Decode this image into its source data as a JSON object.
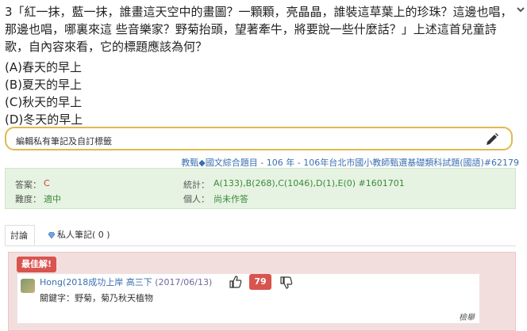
{
  "question": {
    "text": "3「紅一抹，藍一抹，誰畫這天空中的畫圖？一顆顆，亮晶晶，誰裝這草葉上的珍珠？這邊也唱，那邊也唱，哪裏來這 些音樂家？野菊抬頭，望著牽牛，將要說一些什麼話？」上述這首兒童詩歌，自內容來看，它的標題應該為何？",
    "options": [
      "(A)春天的早上",
      "(B)夏天的早上",
      "(C)秋天的早上",
      "(D)冬天的早上"
    ]
  },
  "note": {
    "label": "編輯私有筆記及自訂標籤"
  },
  "meta": {
    "category": "教甄◆國文綜合題目",
    "rest": "- 106 年 - 106年台北市國小教師甄選基礎類科試題(國語)#62179"
  },
  "stats": {
    "answer_label": "答案：",
    "answer_value": "C",
    "difficulty_label": "難度：",
    "difficulty_value": "適中",
    "stats_label": "統計：",
    "stats_value": "A(133),B(268),C(1046),D(1),E(0) #1601701",
    "personal_label": "個人：",
    "personal_value": "尚未作答"
  },
  "tabs": {
    "discussion": "討論",
    "private_notes": "私人筆記( 0 )"
  },
  "best_answer": {
    "badge": "最佳解!",
    "author": "Hong(2018成功上岸 高三下",
    "date": "(2017/06/13)",
    "votes": "79",
    "text": "關鍵字：野菊，菊乃秋天植物",
    "report": "檢舉"
  },
  "colors": {
    "accent_red": "#d9534f",
    "note_border": "#e0b84f",
    "stats_bg": "#e6f3e2",
    "best_bg": "#f3dede",
    "link_blue": "#3a6fb0"
  },
  "icons": [
    "chevron-down-icon",
    "pencil-icon",
    "gem-icon",
    "thumbs-up-icon",
    "thumbs-down-icon"
  ]
}
